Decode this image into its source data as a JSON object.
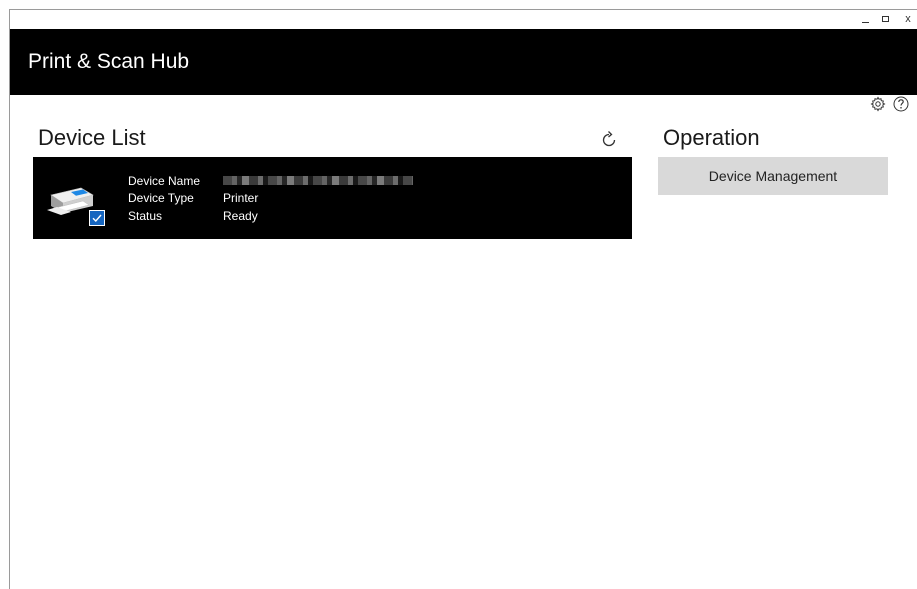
{
  "window": {
    "controls": {
      "minimize_icon": "minimize-icon",
      "maximize_icon": "maximize-icon",
      "close_label": "x"
    }
  },
  "header": {
    "title": "Print & Scan Hub",
    "background": "#000000"
  },
  "toolbar": {
    "settings_icon": "gear-icon",
    "help_icon": "help-circle-icon"
  },
  "device_list": {
    "title": "Device List",
    "refresh_icon": "refresh-icon",
    "devices": [
      {
        "name_label": "Device Name",
        "name_value": "",
        "type_label": "Device Type",
        "type_value": "Printer",
        "status_label": "Status",
        "status_value": "Ready",
        "icon": "printer-icon",
        "selected": true
      }
    ]
  },
  "operation": {
    "title": "Operation",
    "device_management_label": "Device Management",
    "button_color": "#d9d9d9"
  },
  "colors": {
    "accent": "#1565c0",
    "card_background": "#000000"
  }
}
